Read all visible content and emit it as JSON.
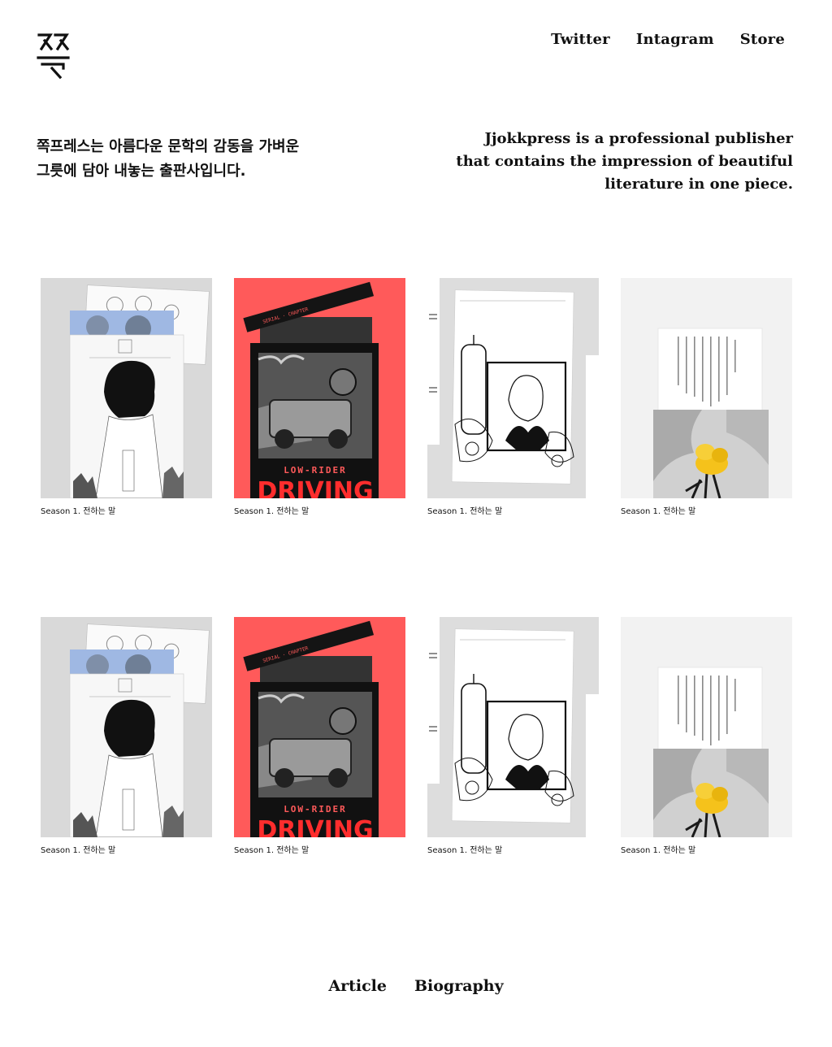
{
  "header": {
    "logo_icon": "jjok-logo-icon",
    "nav": [
      {
        "label": "Twitter"
      },
      {
        "label": "Intagram"
      },
      {
        "label": "Store"
      }
    ]
  },
  "intro": {
    "korean_line1": "쪽프레스는 아름다운 문학의 감동을 가벼운",
    "korean_line2": "그릇에 담아 내놓는 출판사입니다.",
    "english_line1": "Jjokkpress is a professional publisher",
    "english_line2": "that contains the impression of beautiful",
    "english_line3": "literature in one piece."
  },
  "books": [
    {
      "caption": "Season 1. 전하는 말",
      "cover": "boy-illustration",
      "bg": "#d9d9d9"
    },
    {
      "caption": "Season 1. 전하는 말",
      "cover": "low-rider-driving",
      "bg": "#ff5a5a",
      "cover_text": "LOW-RIDER DRIVING"
    },
    {
      "caption": "Season 1. 전하는 말",
      "cover": "woman-candle-illustration",
      "bg": "#dddddd"
    },
    {
      "caption": "Season 1. 전하는 말",
      "cover": "yellow-flower-japanese",
      "bg": "#f2f2f2"
    },
    {
      "caption": "Season 1. 전하는 말",
      "cover": "boy-illustration",
      "bg": "#d9d9d9"
    },
    {
      "caption": "Season 1. 전하는 말",
      "cover": "low-rider-driving",
      "bg": "#ff5a5a",
      "cover_text": "LOW-RIDER DRIVING"
    },
    {
      "caption": "Season 1. 전하는 말",
      "cover": "woman-candle-illustration",
      "bg": "#dddddd"
    },
    {
      "caption": "Season 1. 전하는 말",
      "cover": "yellow-flower-japanese",
      "bg": "#f2f2f2"
    }
  ],
  "footer": {
    "nav": [
      {
        "label": "Article"
      },
      {
        "label": "Biography"
      }
    ]
  },
  "colors": {
    "accent_red": "#ff5a5a",
    "flower_yellow": "#f5c21b",
    "thumb_gray": "#d9d9d9",
    "text": "#111111"
  }
}
